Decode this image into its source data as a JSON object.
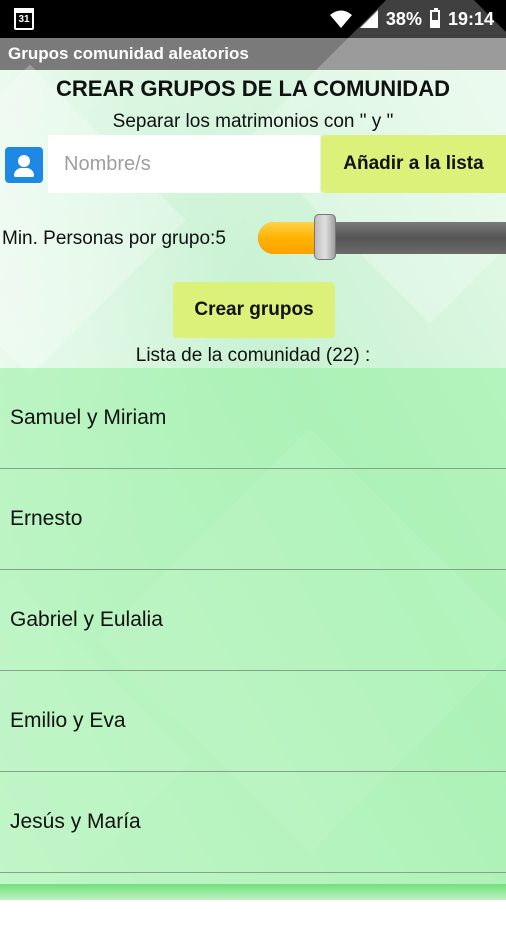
{
  "status_bar": {
    "calendar_day": "31",
    "battery": "38%",
    "time": "19:14"
  },
  "app_bar": {
    "title": "Grupos comunidad aleatorios"
  },
  "header": {
    "title": "CREAR GRUPOS DE LA COMUNIDAD",
    "subtitle": "Separar los matrimonios con \" y \""
  },
  "name_input": {
    "placeholder": "Nombre/s",
    "value": ""
  },
  "add_button": {
    "label": "Añadir a la lista"
  },
  "slider": {
    "label": "Min. Personas por grupo:5",
    "value": 5,
    "fraction": 0.27
  },
  "create_button": {
    "label": "Crear grupos"
  },
  "list": {
    "label": "Lista de la comunidad  (22) :",
    "items": [
      "Samuel y Miriam",
      "Ernesto",
      "Gabriel y Eulalia",
      "Emilio y Eva",
      "Jesús y María"
    ]
  },
  "colors": {
    "button_bg": "#dcf17a",
    "slider_fill": "#ffb300",
    "appbar_bg": "#7a7a7a",
    "list_bg": "#96f0a0"
  }
}
